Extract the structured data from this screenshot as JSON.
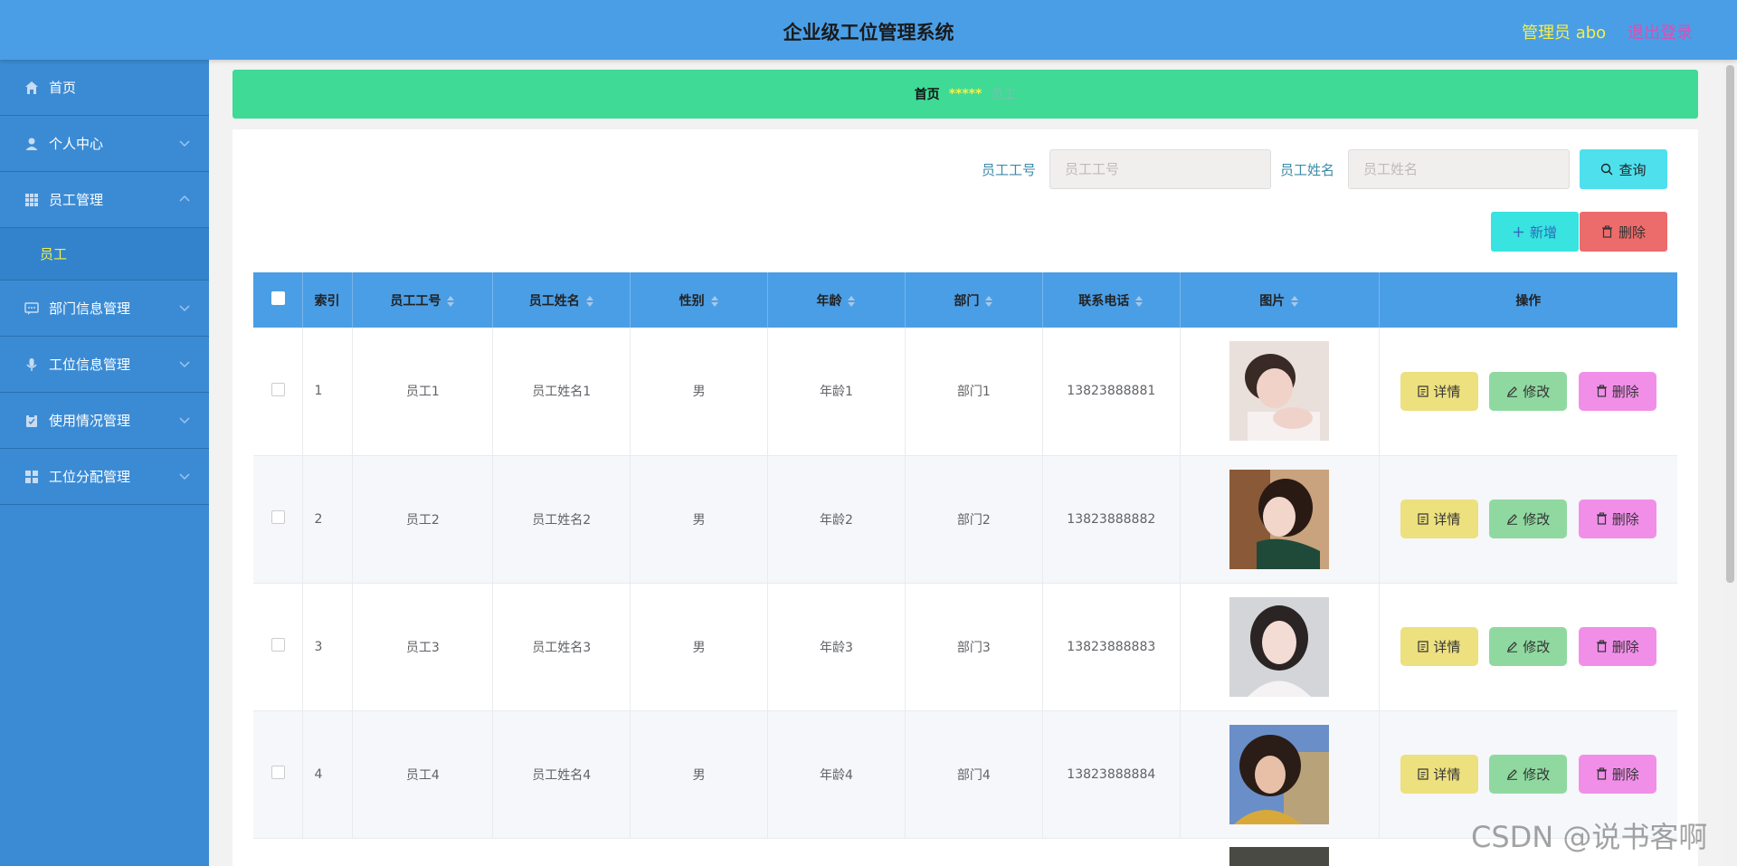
{
  "header": {
    "title": "企业级工位管理系统",
    "admin_label": "管理员 abo",
    "logout_label": "退出登录"
  },
  "sidebar": {
    "items": [
      {
        "label": "首页",
        "icon": "home-icon"
      },
      {
        "label": "个人中心",
        "icon": "user-icon"
      },
      {
        "label": "员工管理",
        "icon": "grid-icon",
        "expanded": true
      },
      {
        "label": "部门信息管理",
        "icon": "chat-icon"
      },
      {
        "label": "工位信息管理",
        "icon": "mic-icon"
      },
      {
        "label": "使用情况管理",
        "icon": "clipboard-icon"
      },
      {
        "label": "工位分配管理",
        "icon": "apps-icon"
      }
    ],
    "sub_item": "员工"
  },
  "breadcrumb": {
    "home": "首页",
    "separator": "*****",
    "current": "员工"
  },
  "search": {
    "emp_no_label": "员工工号",
    "emp_no_placeholder": "员工工号",
    "emp_name_label": "员工姓名",
    "emp_name_placeholder": "员工姓名",
    "query_label": "查询"
  },
  "toolbar": {
    "add_label": "新增",
    "delete_label": "删除"
  },
  "table": {
    "columns": [
      "索引",
      "员工工号",
      "员工姓名",
      "性别",
      "年龄",
      "部门",
      "联系电话",
      "图片",
      "操作"
    ],
    "rows": [
      {
        "index": "1",
        "emp_no": "员工1",
        "name": "员工姓名1",
        "gender": "男",
        "age": "年龄1",
        "dept": "部门1",
        "phone": "13823888881"
      },
      {
        "index": "2",
        "emp_no": "员工2",
        "name": "员工姓名2",
        "gender": "男",
        "age": "年龄2",
        "dept": "部门2",
        "phone": "13823888882"
      },
      {
        "index": "3",
        "emp_no": "员工3",
        "name": "员工姓名3",
        "gender": "男",
        "age": "年龄3",
        "dept": "部门3",
        "phone": "13823888883"
      },
      {
        "index": "4",
        "emp_no": "员工4",
        "name": "员工姓名4",
        "gender": "男",
        "age": "年龄4",
        "dept": "部门4",
        "phone": "13823888884"
      }
    ],
    "actions": {
      "detail": "详情",
      "edit": "修改",
      "delete": "删除"
    }
  },
  "watermark": "CSDN @说书客啊"
}
